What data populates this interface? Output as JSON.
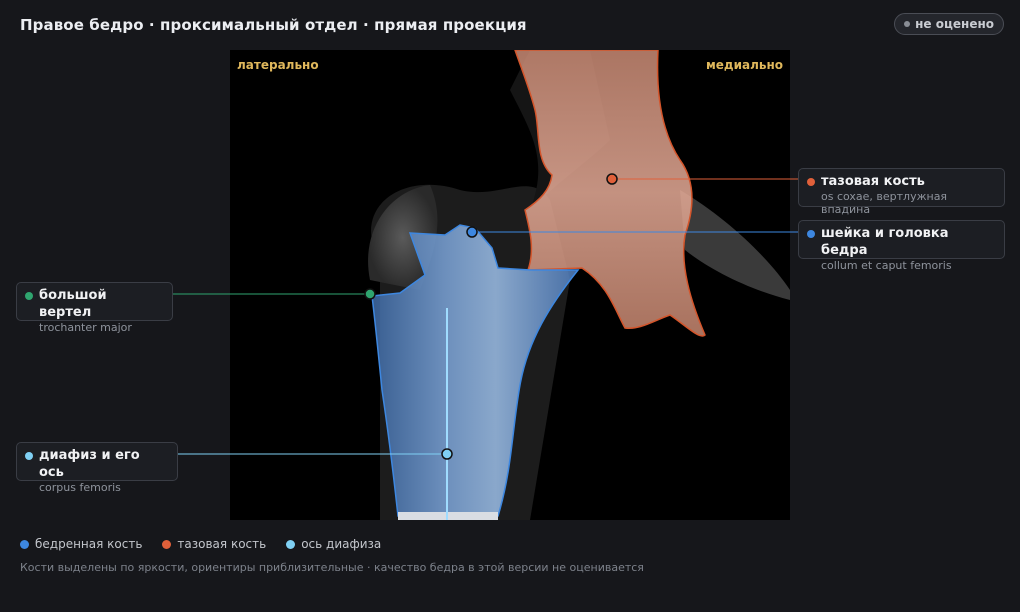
{
  "header": {
    "title": "Правое бедро · проксимальный отдел · прямая проекция",
    "status": "не оценено"
  },
  "viewer": {
    "orientation_left": "латерально",
    "orientation_right": "медиально"
  },
  "landmarks": {
    "pelvis": {
      "name": "тазовая кость",
      "latin": "os coxae, вертлужная впадина",
      "color": "#e0603a"
    },
    "neck": {
      "name": "шейка и головка бедра",
      "latin": "collum et caput femoris",
      "color": "#3d87e0"
    },
    "trochanter": {
      "name": "большой вертел",
      "latin": "trochanter major",
      "color": "#2fa56f"
    },
    "shaft": {
      "name": "диафиз и его ось",
      "latin": "corpus femoris",
      "color": "#7fd0f4"
    }
  },
  "legend": [
    {
      "label": "бедренная кость",
      "color": "#3d87e0"
    },
    {
      "label": "тазовая кость",
      "color": "#e0603a"
    },
    {
      "label": "ось диафиза",
      "color": "#7fd0f4"
    }
  ],
  "footnote": "Кости выделены по яркости, ориентиры приблизительные · качество бедра в этой версии не оценивается"
}
